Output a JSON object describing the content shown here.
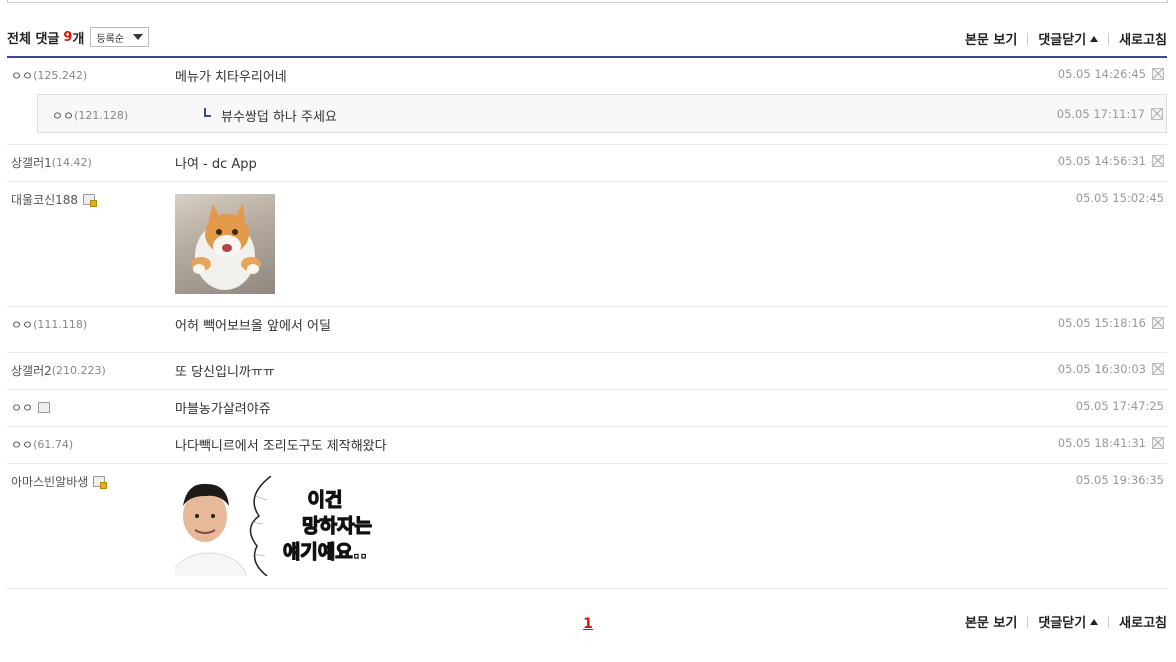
{
  "header": {
    "total_label": "전체 댓글",
    "count": "9",
    "count_unit": "개",
    "sort_selected": "등록순",
    "links": {
      "view_post": "본문 보기",
      "close_comments": "댓글닫기",
      "refresh": "새로고침"
    }
  },
  "comments": [
    {
      "nick": "ㅇㅇ",
      "ip": "(125.242)",
      "text": "메뉴가 치타우리어네",
      "date": "05.05 14:26:45"
    },
    {
      "nick": "ㅇㅇ",
      "ip": "(121.128)",
      "text": "뷰수쌍덥 하나 주세요",
      "date": "05.05 17:11:17"
    },
    {
      "nick": "상갤러1",
      "ip": "(14.42)",
      "text": "나여 - dc App",
      "date": "05.05 14:56:31"
    },
    {
      "nick": "대울코신188",
      "ip": "",
      "text": "",
      "date": "05.05 15:02:45"
    },
    {
      "nick": "ㅇㅇ",
      "ip": "(111.118)",
      "text": "어허 빽어보브올 앞에서 어딜",
      "date": "05.05 15:18:16"
    },
    {
      "nick": "상갤러2",
      "ip": "(210.223)",
      "text": "또 당신입니까ㅠㅠ",
      "date": "05.05 16:30:03"
    },
    {
      "nick": "ㅇㅇ",
      "ip": "",
      "text": "마블농가살려야쥬",
      "date": "05.05 17:47:25"
    },
    {
      "nick": "ㅇㅇ",
      "ip": "(61.74)",
      "text": "나다빽니르에서 조리도구도 제작해왔다",
      "date": "05.05 18:41:31"
    },
    {
      "nick": "아마스빈알바생",
      "ip": "",
      "text": "",
      "date": "05.05 19:36:35"
    }
  ],
  "sticker": {
    "line1": "이건",
    "line2a": "망하자",
    "line2b": "는",
    "line3": "얘기예요.."
  },
  "pager": {
    "current": "1"
  },
  "colors": {
    "accent": "#3b4890",
    "count": "#d31900"
  }
}
